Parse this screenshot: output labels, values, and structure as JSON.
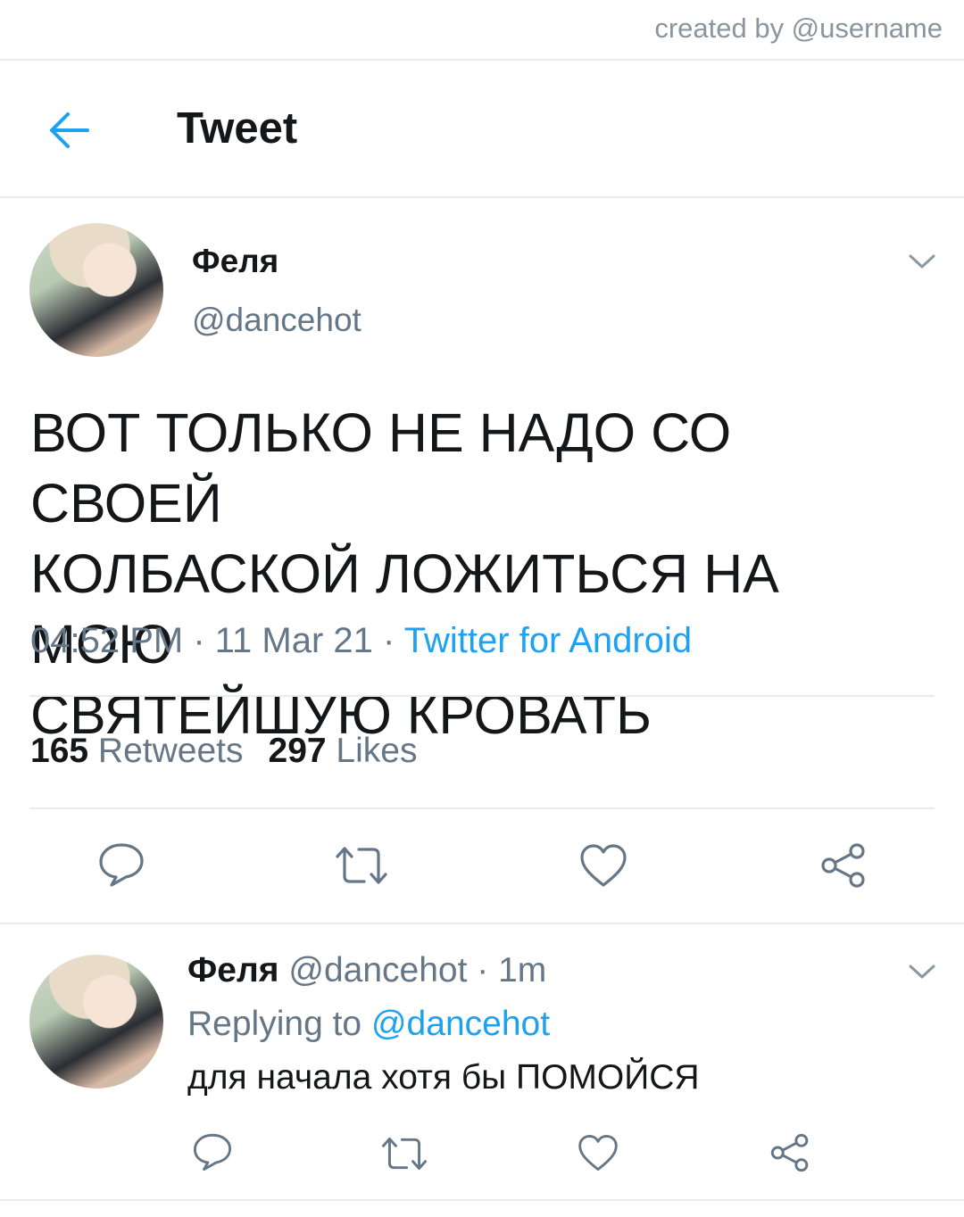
{
  "credit": "created by @username",
  "header": {
    "title": "Tweet",
    "back_icon": "arrow-left-icon"
  },
  "tweet": {
    "author_name": "Феля",
    "author_handle": "@dancehot",
    "text": "ВОТ ТОЛЬКО НЕ НАДО СО СВОЕЙ\nКОЛБАСКОЙ ЛОЖИТЬСЯ НА МОЮ\nСВЯТЕЙШУЮ КРОВАТЬ",
    "time": "04:52 PM",
    "date": "11 Mar 21",
    "separator": " · ",
    "source": "Twitter for Android",
    "retweets_count": "165",
    "retweets_label": "Retweets",
    "likes_count": "297",
    "likes_label": "Likes"
  },
  "reply": {
    "author_name": "Феля",
    "author_handle": "@dancehot",
    "separator": " · ",
    "time_ago": "1m",
    "replying_prefix": "Replying to",
    "replying_handle": "@dancehot",
    "text": "для начала хотя бы ПОМОЙСЯ"
  },
  "colors": {
    "accent": "#1da1f2",
    "icon": "#657786",
    "divider": "#e6ecf0",
    "text": "#14171a"
  }
}
